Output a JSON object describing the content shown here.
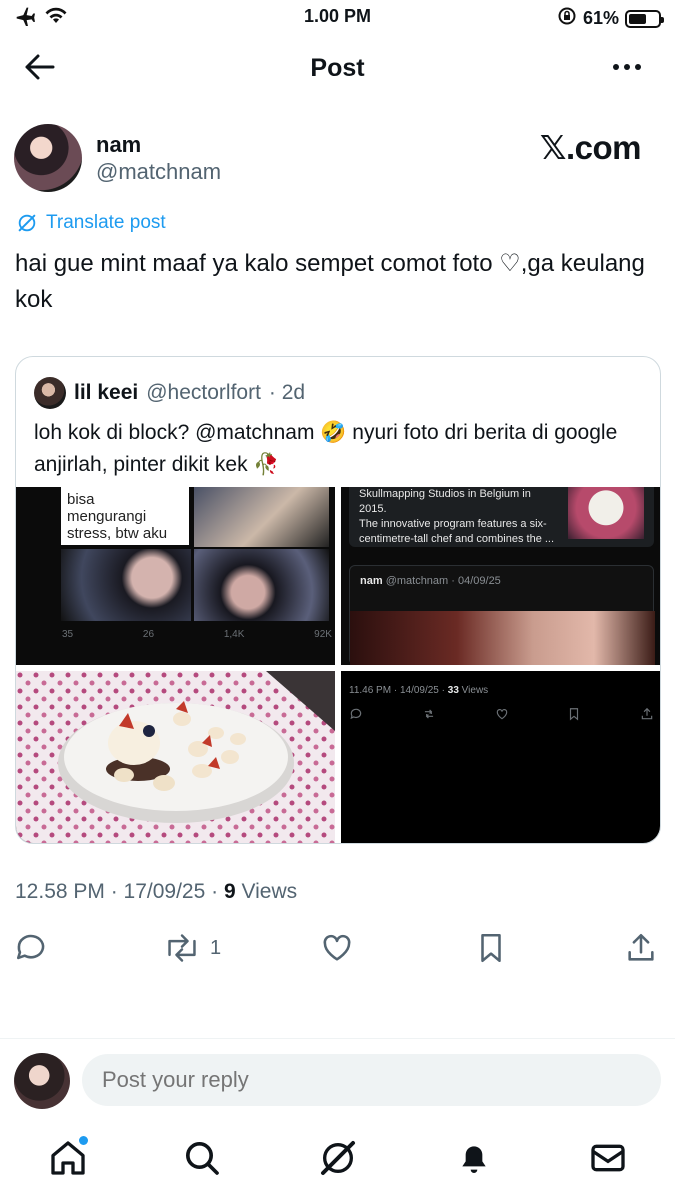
{
  "status_bar": {
    "time": "1.00 PM",
    "battery": "61%",
    "battery_level": 0.61
  },
  "header": {
    "title": "Post"
  },
  "author": {
    "name": "nam",
    "handle": "@matchnam",
    "source": "𝕏.com"
  },
  "translate_label": "Translate post",
  "post_text": "hai gue mint maaf ya kalo sempet comot foto ♡,ga keulang kok",
  "quote": {
    "name": "lil keei",
    "handle": "@hectorlfort",
    "age": "· 2d",
    "text": "loh kok di block? @matchnam 🤣 nyuri foto dri berita di google anjirlah, pinter dikit kek 🥀",
    "img1": {
      "caption_lines": [
        "bisa",
        "mengurangi",
        "stress, btw aku"
      ],
      "stats": [
        "35",
        "26",
        "1,4K",
        "92K"
      ]
    },
    "img2": {
      "article_lines": [
        "Skullmapping Studios in Belgium in 2015.",
        "The innovative program features a six-",
        "centimetre-tall chef and combines the ..."
      ],
      "embedded_author": "nam",
      "embedded_handle": "@matchnam · 04/09/25"
    },
    "img4": {
      "timestamp": "11.46 PM · 14/09/25 · ",
      "views_count": "33",
      "views_label": "Views"
    }
  },
  "meta": {
    "time_date": "12.58 PM · 17/09/25 · ",
    "views_count": "9",
    "views_label": "Views"
  },
  "actions": {
    "repost_count": "1"
  },
  "reply": {
    "placeholder": "Post your reply"
  },
  "colors": {
    "accent": "#1d9bf0",
    "text": "#0f1419",
    "secondary": "#536471",
    "border": "#cfd9de"
  }
}
